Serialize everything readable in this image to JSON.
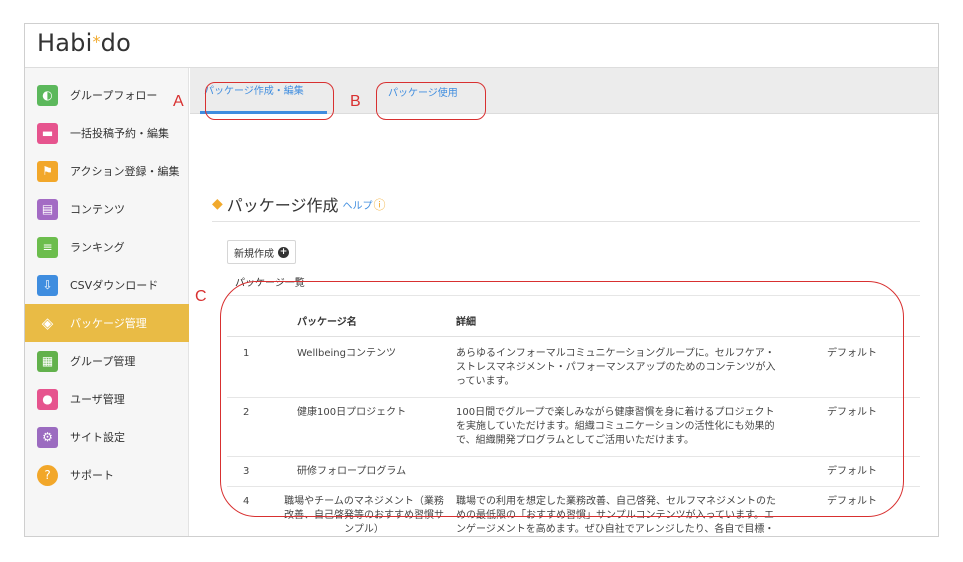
{
  "app": {
    "logo_prefix": "Habi",
    "logo_star": "*",
    "logo_suffix": "do"
  },
  "sidebar": {
    "items": [
      {
        "label": "グループフォロー",
        "icon": "follow-icon",
        "glyph": "◐",
        "color": "#5cb85c"
      },
      {
        "label": "一括投稿予約・編集",
        "icon": "post-schedule-icon",
        "glyph": "▬",
        "color": "#e6548e"
      },
      {
        "label": "アクション登録・編集",
        "icon": "flag-icon",
        "glyph": "⚑",
        "color": "#f2a72a"
      },
      {
        "label": "コンテンツ",
        "icon": "contents-icon",
        "glyph": "▤",
        "color": "#a36bc4"
      },
      {
        "label": "ランキング",
        "icon": "ranking-icon",
        "glyph": "≡",
        "color": "#6cbd4d"
      },
      {
        "label": "CSVダウンロード",
        "icon": "download-icon",
        "glyph": "⇩",
        "color": "#3f8ddf"
      },
      {
        "label": "パッケージ管理",
        "icon": "package-icon",
        "glyph": "◈",
        "color": "#e9bb45"
      },
      {
        "label": "グループ管理",
        "icon": "group-manage-icon",
        "glyph": "▦",
        "color": "#62b14c"
      },
      {
        "label": "ユーザ管理",
        "icon": "users-icon",
        "glyph": "●",
        "color": "#e6548e"
      },
      {
        "label": "サイト設定",
        "icon": "gear-icon",
        "glyph": "⚙",
        "color": "#9b6bc0"
      },
      {
        "label": "サポート",
        "icon": "help-icon",
        "glyph": "?",
        "color": "#f2a72a"
      }
    ]
  },
  "tabs": [
    {
      "label": "パッケージ作成・編集",
      "active": true
    },
    {
      "label": "パッケージ使用",
      "active": false
    }
  ],
  "section": {
    "title": "パッケージ作成",
    "help_link": "ヘルプ",
    "help_icon": "?"
  },
  "new_button": {
    "label": "新規作成",
    "icon": "+"
  },
  "list_label": "パッケージ一覧",
  "table": {
    "headers": {
      "name": "パッケージ名",
      "detail": "詳細"
    },
    "rows": [
      {
        "no": "1",
        "name": "Wellbeingコンテンツ",
        "detail": "あらゆるインフォーマルコミュニケーショングループに。セルフケア・ストレスマネジメント・パフォーマンスアップのためのコンテンツが入っています。",
        "tag": "デフォルト"
      },
      {
        "no": "2",
        "name": "健康100日プロジェクト",
        "detail": "100日間でグループで楽しみながら健康習慣を身に着けるプロジェクトを実施していただけます。組織コミュニケーションの活性化にも効果的で、組織開発プログラムとしてご活用いただけます。",
        "tag": "デフォルト"
      },
      {
        "no": "3",
        "name": "研修フォロープログラム",
        "detail": "",
        "tag": "デフォルト"
      },
      {
        "no": "4",
        "name": "職場やチームのマネジメント（業務改善、自己啓発等のおすすめ習慣サンプル）",
        "detail": "職場での利用を想定した業務改善、自己啓発、セルフマネジメントのための最低限の「おすすめ習慣」サンプルコンテンツが入っています。エンゲージメントを高めます。ぜひ自社でアレンジしたり、各自で目標・習慣をつくってお試しください。",
        "tag": "デフォルト"
      }
    ]
  },
  "annotations": {
    "a": "A",
    "b": "B",
    "c": "C"
  },
  "colors": {
    "accent": "#e9bb45",
    "link": "#3f8ddf",
    "annotation": "#d83030"
  }
}
